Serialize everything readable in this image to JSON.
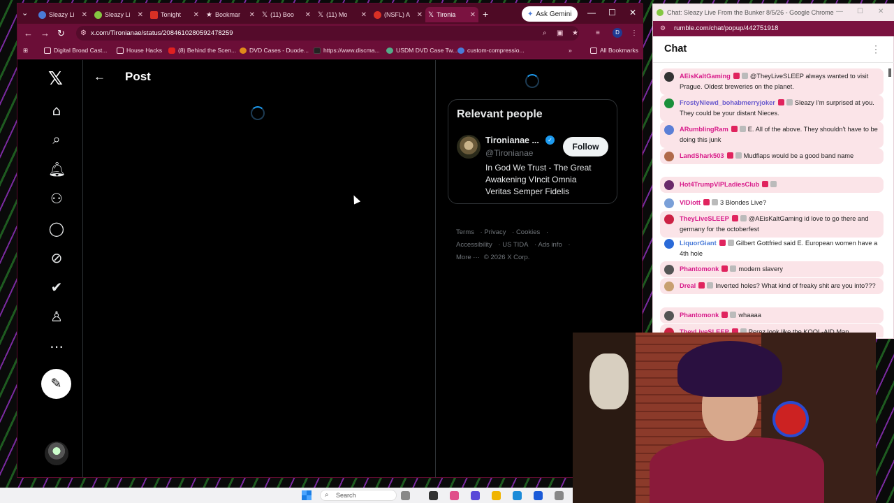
{
  "browser": {
    "tabs": [
      {
        "label": "Sleazy Li",
        "color": "#4a7bd8"
      },
      {
        "label": "Sleazy Li",
        "color": "#85c742"
      },
      {
        "label": "Tonight",
        "color": "#d93025"
      },
      {
        "label": "Bookmar",
        "color": "#ffffff"
      },
      {
        "label": "(11) Boo",
        "color": "#ffffff"
      },
      {
        "label": "(11) Mo",
        "color": "#ffffff"
      },
      {
        "label": "(NSFL) A",
        "color": "#d93025"
      },
      {
        "label": "Tironia",
        "color": "#ffffff"
      }
    ],
    "ask_gemini": "Ask Gemini",
    "url": "x.com/Tironianae/status/2084610280592478259",
    "profile_initial": "D",
    "bookmarks": [
      "Digital Broad Cast...",
      "House Hacks",
      "(8) Behind the Scen...",
      "DVD Cases - Duode...",
      "https://www.discma...",
      "USDM DVD Case Tw...",
      "custom-compressio..."
    ],
    "all_bookmarks": "All Bookmarks"
  },
  "x": {
    "page_title": "Post",
    "relevant_people": {
      "heading": "Relevant people",
      "name": "Tironianae ...",
      "handle": "@Tironianae",
      "follow": "Follow",
      "bio": "In God We Trust - The Great Awakening VIncit Omnia Veritas Semper Fidelis"
    },
    "footer": {
      "terms": "Terms",
      "privacy": "Privacy",
      "cookies": "Cookies",
      "accessibility": "Accessibility",
      "us_tida": "US TIDA",
      "ads_info": "Ads info",
      "more": "More ···",
      "copyright": "© 2026 X Corp."
    }
  },
  "rumble": {
    "window_title": "Chat: Sleazy Live From the Bunker 8/5/26 - Google Chrome",
    "url": "rumble.com/chat/popup/442751918",
    "chat_title": "Chat",
    "messages": [
      {
        "user": "AEisKaltGaming",
        "color": "#d81b8a",
        "text": "@TheyLiveSLEEP always wanted to visit Prague. Oldest breweries on the planet.",
        "avatar": "#333333"
      },
      {
        "user": "FrostyNlewd_bohabmerryjoker",
        "color": "#6a5acd",
        "text": "Sleazy I'm surprised at you. They could be your distant Nieces.",
        "avatar": "#1a8f3a"
      },
      {
        "user": "ARumblingRam",
        "color": "#d81b8a",
        "text": "E. All of the above. They shouldn't have to be doing this junk",
        "avatar": "#5b7fd6"
      },
      {
        "user": "LandShark503",
        "color": "#d81b8a",
        "text": "Mudflaps would be a good band name",
        "avatar": "#b06a4a"
      },
      {
        "user": "Hot4TrumpVIPLadiesClub",
        "color": "#d81b8a",
        "text": "",
        "avatar": "#6a2a6a"
      },
      {
        "user": "VIDiott",
        "color": "#d81b8a",
        "text": "3 Blondes Live?",
        "avatar": "#7aa0d8"
      },
      {
        "user": "TheyLiveSLEEP",
        "color": "#d81b8a",
        "text": "@AEisKaltGaming id love to go there and germany for the octoberfest",
        "avatar": "#c24"
      },
      {
        "user": "LiquorGiant",
        "color": "#4a7bd8",
        "text": "Gilbert Gottfried said E. European women have a 4th hole",
        "avatar": "#2a6ad8"
      },
      {
        "user": "Phantomonk",
        "color": "#d81b8a",
        "text": "modern slavery",
        "avatar": "#555555"
      },
      {
        "user": "Dreal",
        "color": "#d81b8a",
        "text": "Inverted holes? What kind of freaky shit are you into???",
        "avatar": "#c8a070"
      },
      {
        "user": "Phantomonk",
        "color": "#d81b8a",
        "text": "whaaaa",
        "avatar": "#555555"
      },
      {
        "user": "TheyLiveSLEEP",
        "color": "#d81b8a",
        "text": "Perez look like the KOOL-AID Man",
        "avatar": "#c24"
      }
    ]
  },
  "taskbar": {
    "search": "Search"
  }
}
